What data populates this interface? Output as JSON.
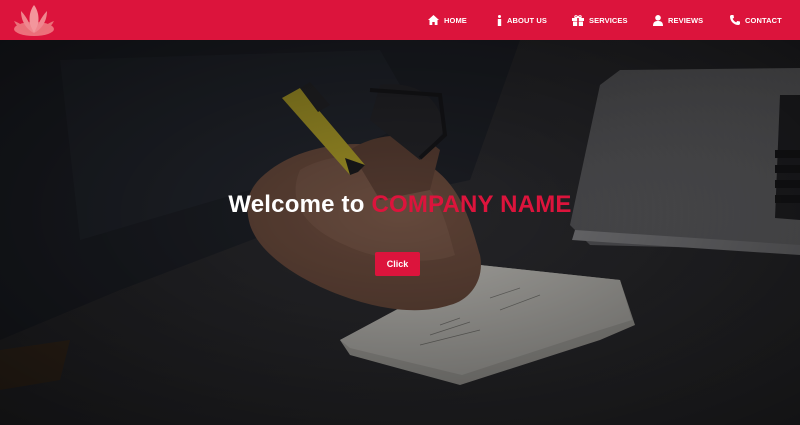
{
  "theme": {
    "accent": "#dc143c",
    "text": "#ffffff"
  },
  "nav": {
    "logo_icon": "lotus-logo",
    "items": [
      {
        "label": "HOME",
        "icon": "home-icon"
      },
      {
        "label": "ABOUT US",
        "icon": "info-icon"
      },
      {
        "label": "SERVICES",
        "icon": "gift-icon"
      },
      {
        "label": "REVIEWS",
        "icon": "user-icon"
      },
      {
        "label": "CONTACT",
        "icon": "phone-icon"
      }
    ]
  },
  "hero": {
    "background": "photo of hand writing with a pen on notepaper next to a laptop",
    "welcome": "Welcome to",
    "company": "COMPANY NAME",
    "button_label": "Click"
  }
}
